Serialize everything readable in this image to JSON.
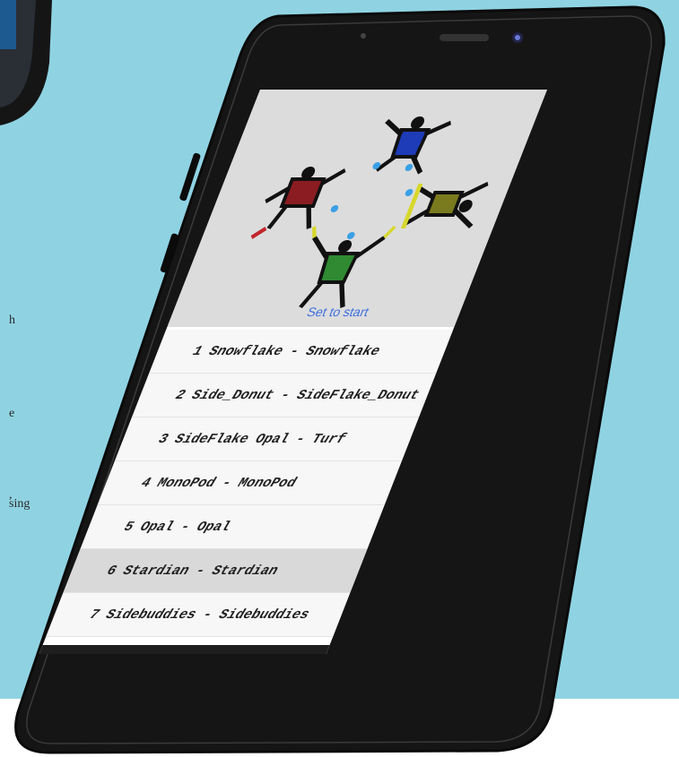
{
  "fragments": [
    "h",
    "e",
    ",",
    "sing"
  ],
  "screen": {
    "set_to_start": "Set to start",
    "items": [
      {
        "label": "1 Snowflake - Snowflake"
      },
      {
        "label": "2 Side_Donut - SideFlake_Donut"
      },
      {
        "label": "3 SideFlake Opal - Turf"
      },
      {
        "label": "4 MonoPod - MonoPod"
      },
      {
        "label": "5 Opal - Opal"
      },
      {
        "label": "6 Stardian - Stardian",
        "selected": true
      },
      {
        "label": "7  Sidebuddies - Sidebuddies"
      }
    ]
  },
  "colors": {
    "background": "#8fd3e3",
    "phone_body": "#151515",
    "accent_blue": "#3d6fe0",
    "diver_red": "#c0262c",
    "diver_blue": "#1e3bb8",
    "diver_yellow": "#d7d72c",
    "diver_green": "#2f8a32"
  }
}
